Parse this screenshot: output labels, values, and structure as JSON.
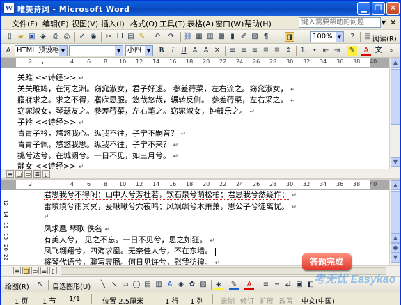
{
  "window": {
    "title": "唯美诗词 - Microsoft Word",
    "app_icon": "W"
  },
  "menubar": {
    "items": [
      "文件(F)",
      "编辑(E)",
      "视图(V)",
      "插入(I)",
      "格式(O)",
      "工具(T)",
      "表格(A)",
      "窗口(W)",
      "帮助(H)"
    ],
    "help_placeholder": "键入需要帮助的问题"
  },
  "toolbar": {
    "zoom": "100%",
    "read_label": "阅读(R)"
  },
  "format_toolbar": {
    "style": "HTML 预设格式",
    "font": "",
    "size": "小四"
  },
  "top_pane": {
    "lines": [
      "关雎  <<诗经>>",
      "关关雎鸠，在河之洲。窈窕淑女，君子好逑。 参差荇菜，左右流之。窈窕淑女，",
      "寤寐求之。求之不得，寤寐思服。悠哉悠哉，辗转反侧。 参差荇菜，左右采之。",
      "窈窕淑女，琴瑟友之。参差荇菜，左右芼之。窈窕淑女，钟鼓乐之。",
      "子衿  <<诗经>>",
      "青青子衿，悠悠我心。纵我不往，子宁不嗣音？",
      "青青子佩，悠悠我思。纵我不往，子宁不来？",
      "挑兮达兮，在城阙兮。一日不见，如三月兮。",
      "静女  <<诗经>>"
    ]
  },
  "bottom_pane": {
    "lines": [
      "君思我兮不得闲；山中人兮芳杜若，饮石泉兮荫松柏；君思我兮然疑作；",
      "雷填填兮雨冥冥，爰啾啾兮穴夜鸣；风飒飒兮木萧萧，思公子兮徒离忧。",
      "",
      "凤求凰 琴歌  佚名",
      "有美人兮， 见之不忘。一日不见兮，思之如狂。",
      "凤飞翱翔兮，四海求凰。无奈佳人兮，不在东墙。",
      "将琴代语兮，聊写衷肠。何日见许兮，慰我彷徨。"
    ]
  },
  "ruler_numbers": [
    "2",
    "2",
    "4",
    "6",
    "8",
    "10",
    "12",
    "14",
    "16",
    "18",
    "20",
    "22",
    "24",
    "26",
    "28",
    "30",
    "32",
    "34",
    "36",
    "38",
    "40"
  ],
  "left_ruler_numbers": [
    "12",
    "14",
    "16",
    "18",
    "20",
    "22",
    "24"
  ],
  "drawbar": {
    "draw_label": "绘图(R)",
    "autoshape_label": "自选图形(U)"
  },
  "statusbar": {
    "page": "1 页",
    "section": "1 节",
    "pos": "1/1",
    "location": "位置 2.5厘米",
    "line": "1 行",
    "col": "1 列",
    "rec": "录制",
    "trk": "修订",
    "ext": "扩展",
    "ovr": "改写",
    "lang": "中文(中国)"
  },
  "badge": {
    "text": "答题完成"
  },
  "watermark": {
    "text": "考无忧 Easykao"
  }
}
